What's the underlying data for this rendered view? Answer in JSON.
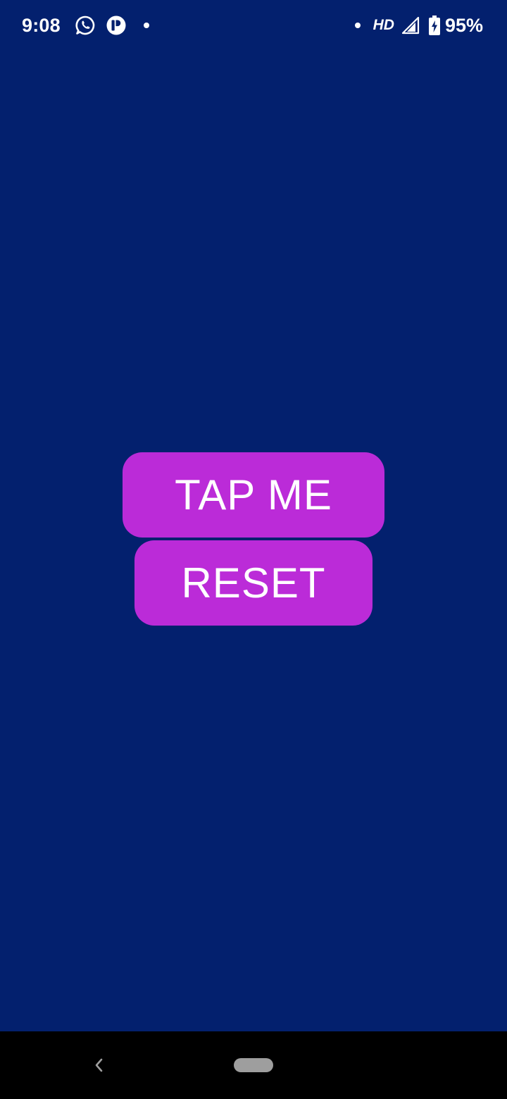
{
  "status_bar": {
    "time": "9:08",
    "network": "HD",
    "battery_percent": "95%",
    "left_icons": [
      "whatsapp-icon",
      "app-notification-icon",
      "notification-dot-icon"
    ],
    "right_icons": [
      "notification-dot-icon",
      "signal-icon",
      "battery-charging-icon"
    ]
  },
  "main": {
    "tap_button_label": "TAP ME",
    "reset_button_label": "RESET"
  },
  "nav_bar": {
    "icons": [
      "back-icon",
      "home-pill-icon"
    ]
  },
  "colors": {
    "background": "#03206e",
    "button": "#bb2bd8",
    "button_text": "#ffffff",
    "nav_bar": "#000000"
  }
}
